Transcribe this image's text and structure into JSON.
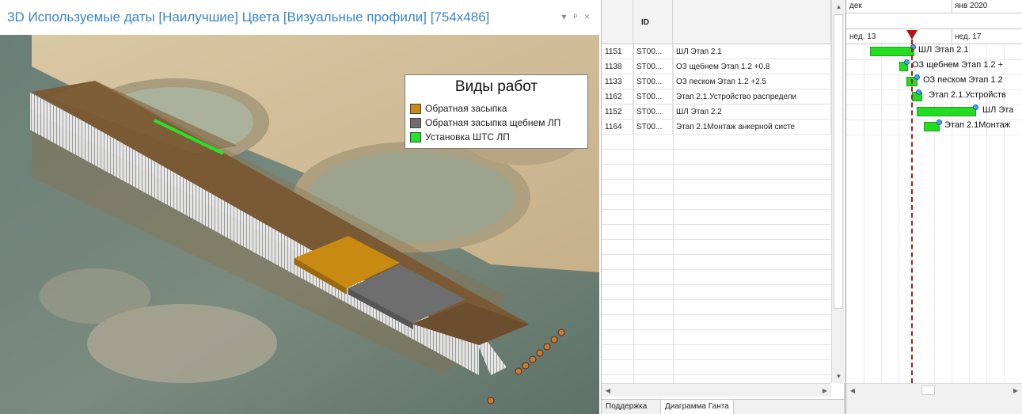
{
  "viewport": {
    "title": "3D Используемые даты [Наилучшие] Цвета [Визуальные профили]  [754x486]",
    "controls": {
      "dropdown": "▾",
      "pin": "ᵖ",
      "close": "×"
    },
    "legend": {
      "title": "Виды работ",
      "items": [
        {
          "label": "Обратная засыпка",
          "color": "#c98a12"
        },
        {
          "label": "Обратная засыпка щебнем ЛП",
          "color": "#6e6e6e"
        },
        {
          "label": "Установка ШТС ЛП",
          "color": "#27e327"
        }
      ]
    }
  },
  "grid": {
    "columns": [
      "",
      "ID",
      ""
    ],
    "rows": [
      {
        "num": "1151",
        "id": "ST00...",
        "name": "ШЛ Этап 2.1"
      },
      {
        "num": "1138",
        "id": "ST00...",
        "name": "ОЗ щебнем Этап 1.2 +0.8"
      },
      {
        "num": "1133",
        "id": "ST00...",
        "name": "ОЗ песком Этап 1.2 +2.5"
      },
      {
        "num": "1162",
        "id": "ST00...",
        "name": "Этап 2.1.Устройство распредели"
      },
      {
        "num": "1152",
        "id": "ST00...",
        "name": "ШЛ Этап 2.2"
      },
      {
        "num": "1164",
        "id": "ST00...",
        "name": "Этап 2.1Монтаж анкерной систе"
      }
    ],
    "tabs": [
      "Поддержка",
      "Диаграмма Ганта"
    ]
  },
  "gantt": {
    "month_left": "дек",
    "month_right": "янв 2020",
    "week_left": "нед. 13",
    "week_right": "нед. 17",
    "bars": [
      {
        "label": "ШЛ Этап 2.1"
      },
      {
        "label": "ОЗ щебнем Этап 1.2 +"
      },
      {
        "label": "ОЗ песком Этап 1.2"
      },
      {
        "label": "Этап 2.1.Устройств"
      },
      {
        "label": "ШЛ Эта"
      },
      {
        "label": "Этап 2.1Монтаж"
      }
    ]
  }
}
